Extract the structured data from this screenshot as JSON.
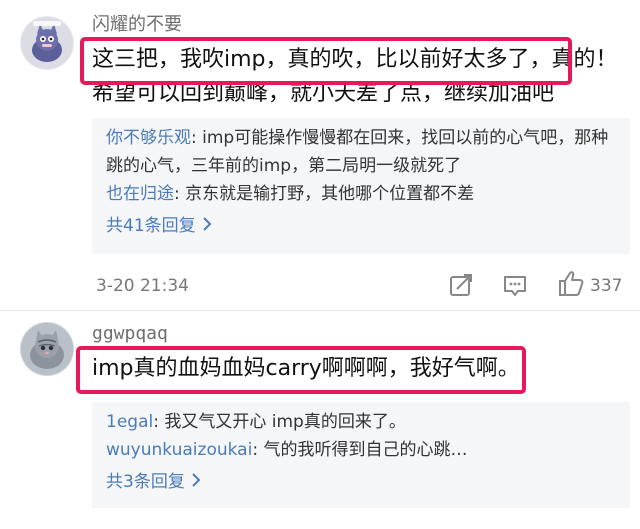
{
  "comments": [
    {
      "username": "闪耀的不要",
      "text": "这三把，我吹imp，真的吹，比以前好太多了，真的！希望可以回到巅峰，就小夭差了点，继续加油吧",
      "replies": [
        {
          "user": "你不够乐观",
          "sep": ":",
          "text": " imp可能操作慢慢都在回来，找回以前的心气吧，那种跳的心气，三年前的imp，第二局明一级就死了"
        },
        {
          "user": "也在归途",
          "sep": ":",
          "text": " 京东就是输打野，其他哪个位置都不差"
        }
      ],
      "more_replies": "共41条回复",
      "timestamp": "3-20 21:34",
      "like_count": "337"
    },
    {
      "username": "ggwpqaq",
      "text": "imp真的血妈血妈carry啊啊啊，我好气啊。",
      "replies": [
        {
          "user": "1egal",
          "sep": ":",
          "text": " 我又气又开心 imp真的回来了。"
        },
        {
          "user": "wuyunkuaizoukai",
          "sep": ":",
          "text": " 气的我听得到自己的心跳…"
        }
      ],
      "more_replies": "共3条回复"
    }
  ],
  "icons": {
    "share": "share-icon",
    "comment": "comment-icon",
    "like": "thumbs-up-icon",
    "more": "chevron-right-icon"
  },
  "colors": {
    "highlight": "#e6195b",
    "link": "#4a7bb7",
    "reply_bg": "#f5f6f8"
  }
}
